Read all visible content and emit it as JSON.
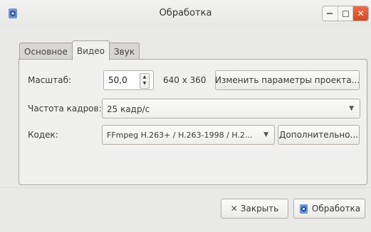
{
  "window": {
    "title": "Обработка",
    "app_icon": "render-gear-icon",
    "buttons": {
      "minimize": "minimize-icon",
      "maximize": "maximize-icon",
      "close": "✕"
    }
  },
  "tabs": [
    {
      "label": "Основное",
      "active": false
    },
    {
      "label": "Видео",
      "active": true
    },
    {
      "label": "Звук",
      "active": false
    }
  ],
  "video": {
    "scale_label": "Масштаб:",
    "scale_value": "50,0",
    "resolution": "640 x 360",
    "change_project_button": "Изменить параметры проекта...",
    "framerate_label": "Частота кадров:",
    "framerate_value": "25 кадр/с",
    "codec_label": "Кодек:",
    "codec_value": "FFmpeg H.263+ / H.263-1998 / H.2...",
    "advanced_button": "Дополнительно..."
  },
  "footer": {
    "close_button": "Закрыть",
    "close_icon": "✕",
    "render_button": "Обработка"
  },
  "colors": {
    "close_accent": "#e05a33",
    "render_icon_blue": "#4f78c8"
  }
}
